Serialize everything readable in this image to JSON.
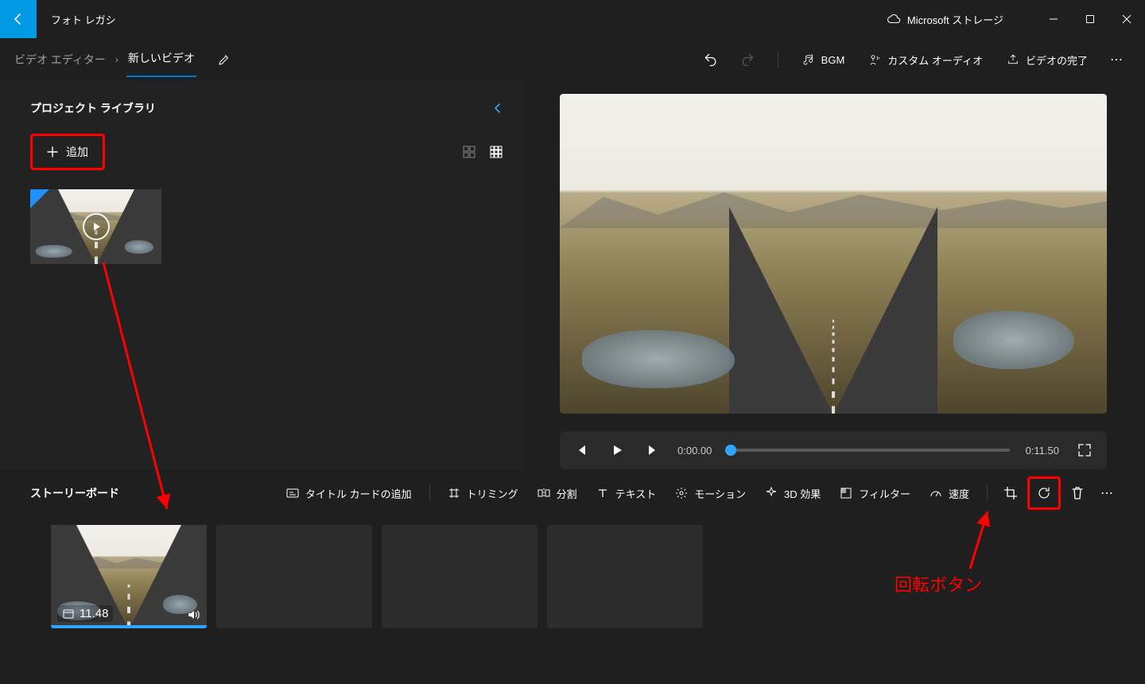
{
  "titlebar": {
    "app_name": "フォト レガシ",
    "storage_label": "Microsoft ストレージ"
  },
  "tabbar": {
    "breadcrumb_root": "ビデオ エディター",
    "project_name": "新しいビデオ",
    "bgm_label": "BGM",
    "custom_audio_label": "カスタム オーディオ",
    "finish_label": "ビデオの完了"
  },
  "library": {
    "title": "プロジェクト ライブラリ",
    "add_label": "追加"
  },
  "player": {
    "current_time": "0:00.00",
    "total_time": "0:11.50"
  },
  "storyboard": {
    "title": "ストーリーボード",
    "add_title_card": "タイトル カードの追加",
    "trim": "トリミング",
    "split": "分割",
    "text": "テキスト",
    "motion": "モーション",
    "effects_3d": "3D 効果",
    "filter": "フィルター",
    "speed": "速度",
    "clip_duration": "11.48"
  },
  "annotation": {
    "rotate_label": "回転ボタン"
  }
}
